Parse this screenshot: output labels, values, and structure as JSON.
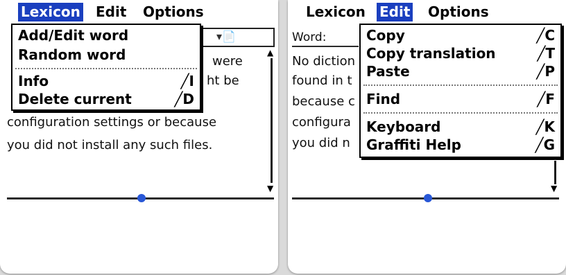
{
  "left": {
    "menubar": [
      {
        "label": "Lexicon",
        "active": true
      },
      {
        "label": "Edit",
        "active": false
      },
      {
        "label": "Options",
        "active": false
      }
    ],
    "menu": {
      "items": [
        {
          "label": "Add/Edit word",
          "shortcut": ""
        },
        {
          "label": "Random word",
          "shortcut": ""
        },
        {
          "label": "Info",
          "shortcut": "╱I"
        },
        {
          "label": "Delete current",
          "shortcut": "╱D"
        }
      ]
    },
    "body_fragments": [
      "were",
      "ht be"
    ],
    "body_lines": [
      "configuration settings or because",
      "you did not install any such files."
    ],
    "field_icons": "▾📄"
  },
  "right": {
    "menubar": [
      {
        "label": "Lexicon",
        "active": false
      },
      {
        "label": "Edit",
        "active": true
      },
      {
        "label": "Options",
        "active": false
      }
    ],
    "word_label": "Word:",
    "body_fragments": [
      "No diction",
      "found in t",
      "because c",
      "configura",
      "you did n"
    ],
    "menu": {
      "items": [
        {
          "label": "Copy",
          "shortcut": "╱C"
        },
        {
          "label": "Copy translation",
          "shortcut": "╱T"
        },
        {
          "label": "Paste",
          "shortcut": "╱P"
        },
        {
          "label": "Find",
          "shortcut": "╱F"
        },
        {
          "label": "Keyboard",
          "shortcut": "╱K"
        },
        {
          "label": "Graffiti Help",
          "shortcut": "╱G"
        }
      ]
    }
  },
  "colors": {
    "menu_highlight": "#1a3fbf",
    "scroll_dot": "#2857d6"
  }
}
